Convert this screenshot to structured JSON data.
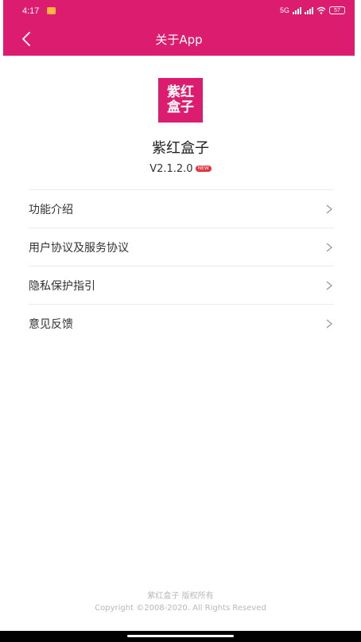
{
  "status_bar": {
    "time": "4:17",
    "network": "5G",
    "battery": "57"
  },
  "header": {
    "back_icon": "chevron-left-icon",
    "title": "关于App"
  },
  "app": {
    "logo_line1": "紫红",
    "logo_line2": "盒子",
    "name": "紫红盒子",
    "version": "V2.1.2.0",
    "badge": "NEW"
  },
  "menu": {
    "items": [
      {
        "label": "功能介绍",
        "icon": "chevron-right-icon"
      },
      {
        "label": "用户协议及服务协议",
        "icon": "chevron-right-icon"
      },
      {
        "label": "隐私保护指引",
        "icon": "chevron-right-icon"
      },
      {
        "label": "意见反馈",
        "icon": "chevron-right-icon"
      }
    ]
  },
  "footer": {
    "line1": "紫红盒子 版权所有",
    "line2": "Copyright ©2008-2020. All Rights Reseved"
  },
  "colors": {
    "brand": "#dc1c6e",
    "badge": "#e8323c"
  }
}
